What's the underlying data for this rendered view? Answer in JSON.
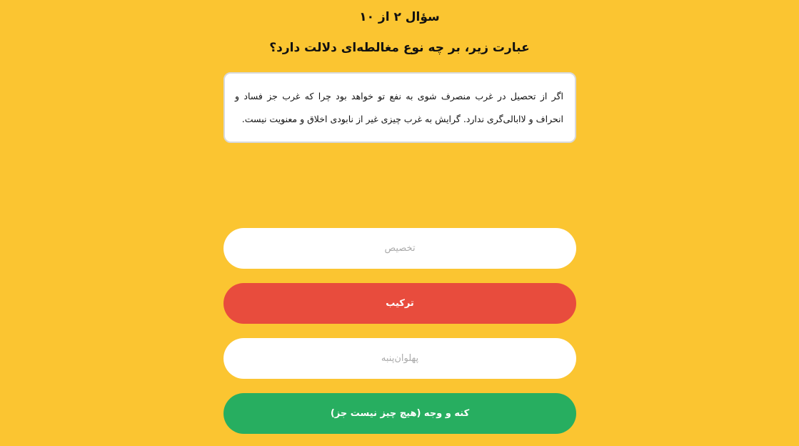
{
  "quiz": {
    "counter": "سؤال ۲ از ۱۰",
    "prompt": "عبارت زیر، بر چه نوع مغالطه‌ای دلالت دارد؟",
    "statement": "اگر از تحصیل در غرب منصرف شوی به نفع تو خواهد بود چرا که غرب جز فساد و انحراف و لاابالی‌گری ندارد. گرایش به غرب چیزی غیر از نابودی اخلاق و معنویت نیست."
  },
  "options": [
    {
      "label": "تخصیص",
      "state": "default"
    },
    {
      "label": "ترکیب",
      "state": "wrong"
    },
    {
      "label": "پهلوان‌پنبه",
      "state": "default"
    },
    {
      "label": "کنه و وجه (هیچ چیز نیست جز)",
      "state": "correct"
    }
  ],
  "colors": {
    "background": "#FBC531",
    "wrong": "#E84C3D",
    "correct": "#27AE60",
    "default": "#ffffff"
  }
}
